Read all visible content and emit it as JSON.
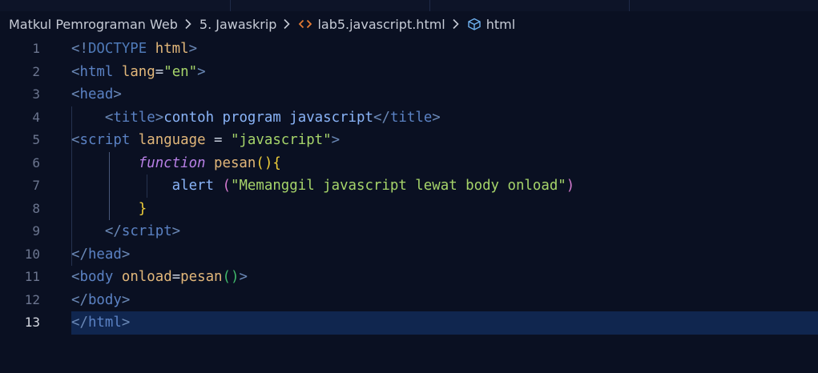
{
  "breadcrumb": {
    "items": [
      "Matkul Pemrograman Web",
      "5. Jawaskrip",
      "lab5.javascript.html",
      "html"
    ]
  },
  "editor": {
    "current_line": 13,
    "lines": [
      {
        "n": "1",
        "tokens": [
          [
            "t-punc",
            "<!"
          ],
          [
            "t-doctype",
            "DOCTYPE"
          ],
          [
            "t-text",
            " "
          ],
          [
            "t-attr",
            "html"
          ],
          [
            "t-punc",
            ">"
          ]
        ]
      },
      {
        "n": "2",
        "tokens": [
          [
            "t-punc",
            "<"
          ],
          [
            "t-tag",
            "html"
          ],
          [
            "t-text",
            " "
          ],
          [
            "t-attr",
            "lang"
          ],
          [
            "t-text",
            "="
          ],
          [
            "t-str",
            "\"en\""
          ],
          [
            "t-punc",
            ">"
          ]
        ]
      },
      {
        "n": "3",
        "tokens": [
          [
            "t-punc",
            "<"
          ],
          [
            "t-tag",
            "head"
          ],
          [
            "t-punc",
            ">"
          ]
        ]
      },
      {
        "n": "4",
        "tokens": [
          [
            "t-text",
            "    "
          ],
          [
            "t-punc",
            "<"
          ],
          [
            "t-tag",
            "title"
          ],
          [
            "t-punc",
            ">"
          ],
          [
            "t-fn",
            "contoh program javascript"
          ],
          [
            "t-punc",
            "</"
          ],
          [
            "t-tag",
            "title"
          ],
          [
            "t-punc",
            ">"
          ]
        ]
      },
      {
        "n": "5",
        "tokens": [
          [
            "t-punc",
            "<"
          ],
          [
            "t-tag",
            "script"
          ],
          [
            "t-text",
            " "
          ],
          [
            "t-attr",
            "language"
          ],
          [
            "t-text",
            " = "
          ],
          [
            "t-str",
            "\"javascript\""
          ],
          [
            "t-punc",
            ">"
          ]
        ]
      },
      {
        "n": "6",
        "tokens": [
          [
            "t-text",
            "        "
          ],
          [
            "t-kw",
            "function"
          ],
          [
            "t-text",
            " "
          ],
          [
            "t-attr",
            "pesan"
          ],
          [
            "t-brace",
            "(){"
          ]
        ]
      },
      {
        "n": "7",
        "tokens": [
          [
            "t-text",
            "            "
          ],
          [
            "t-fn",
            "alert"
          ],
          [
            "t-text",
            " "
          ],
          [
            "t-paren2",
            "("
          ],
          [
            "t-str",
            "\"Memanggil javascript lewat body onload\""
          ],
          [
            "t-paren2",
            ")"
          ]
        ]
      },
      {
        "n": "8",
        "tokens": [
          [
            "t-text",
            "        "
          ],
          [
            "t-brace",
            "}"
          ]
        ]
      },
      {
        "n": "9",
        "tokens": [
          [
            "t-text",
            "    "
          ],
          [
            "t-punc",
            "</"
          ],
          [
            "t-tag",
            "script"
          ],
          [
            "t-punc",
            ">"
          ]
        ]
      },
      {
        "n": "10",
        "tokens": [
          [
            "t-punc",
            "</"
          ],
          [
            "t-tag",
            "head"
          ],
          [
            "t-punc",
            ">"
          ]
        ]
      },
      {
        "n": "11",
        "tokens": [
          [
            "t-punc",
            "<"
          ],
          [
            "t-tag",
            "body"
          ],
          [
            "t-text",
            " "
          ],
          [
            "t-attr",
            "onload"
          ],
          [
            "t-text",
            "="
          ],
          [
            "t-attr",
            "pesan"
          ],
          [
            "t-paren3",
            "()"
          ],
          [
            "t-punc",
            ">"
          ]
        ]
      },
      {
        "n": "12",
        "tokens": [
          [
            "t-punc",
            "</"
          ],
          [
            "t-tag",
            "body"
          ],
          [
            "t-punc",
            ">"
          ]
        ]
      },
      {
        "n": "13",
        "tokens": [
          [
            "t-punc",
            "</"
          ],
          [
            "t-tag",
            "html"
          ],
          [
            "t-punc",
            ">"
          ]
        ]
      }
    ]
  },
  "icons": {
    "breadcrumb_separator": "chevron-right-icon",
    "file_icon": "html-code-brackets-icon",
    "symbol_icon": "cube-symbol-icon"
  },
  "colors": {
    "background": "#0a1022",
    "current_line": "#10264f",
    "tag": "#5b82c4",
    "attribute": "#e2b77a",
    "string": "#a6d46a",
    "keyword": "#b880e6",
    "brace": "#f0cf3a"
  }
}
